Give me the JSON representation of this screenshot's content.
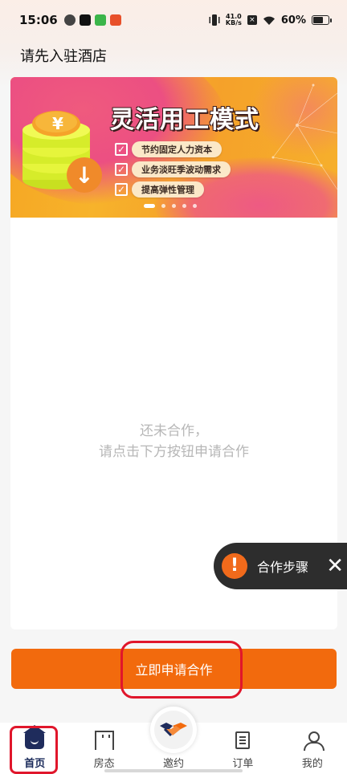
{
  "status_bar": {
    "time": "15:06",
    "net_speed_value": "41.0",
    "net_speed_unit": "KB/s",
    "battery": "60%"
  },
  "header": {
    "title": "请先入驻酒店"
  },
  "banner": {
    "title": "灵活用工模式",
    "items": [
      "节约固定人力资本",
      "业务淡旺季波动需求",
      "提高弹性管理"
    ],
    "coin_symbol": "¥",
    "slide_count": 5,
    "active_slide": 1
  },
  "empty_state": {
    "line1": "还未合作，",
    "line2": "请点击下方按钮申请合作"
  },
  "steps_float": {
    "icon": "!",
    "label": "合作步骤"
  },
  "apply_button": {
    "label": "立即申请合作"
  },
  "tab_bar": {
    "items": [
      {
        "label": "首页",
        "icon": "home-icon",
        "active": true
      },
      {
        "label": "房态",
        "icon": "room-icon",
        "active": false
      },
      {
        "label": "邀约",
        "icon": "handshake-icon",
        "active": false
      },
      {
        "label": "订单",
        "icon": "order-icon",
        "active": false
      },
      {
        "label": "我的",
        "icon": "profile-icon",
        "active": false
      }
    ]
  },
  "colors": {
    "accent": "#f26a0d",
    "tab_active": "#1f2c5c",
    "annotation": "#e0162b"
  }
}
